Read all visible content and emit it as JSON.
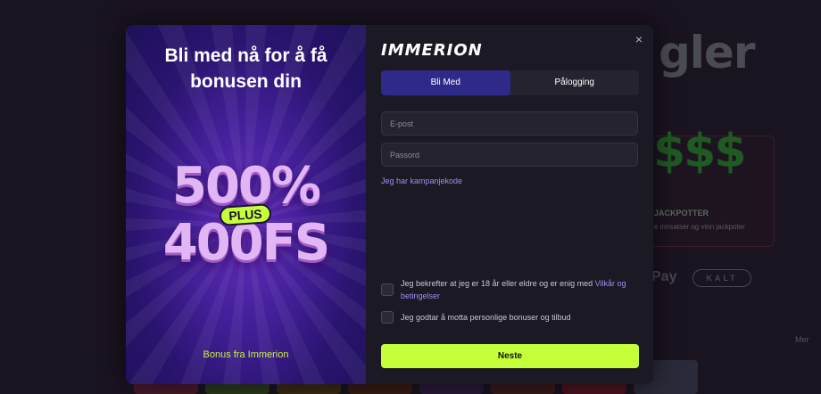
{
  "background": {
    "title_fragment": "gler",
    "jackpot_symbol": "$$$",
    "jackpot_title": "JACKPOTTER",
    "jackpot_sub": "e innsatser og vinn jackpoter",
    "pay_text": "Pay",
    "klarna_text": "KALT",
    "more_label": "Mer"
  },
  "promo": {
    "title": "Bli med nå for å få bonusen din",
    "big_top": "500%",
    "plus": "PLUS",
    "big_bottom": "400FS",
    "caption": "Bonus fra Immerion"
  },
  "form": {
    "logo": "IMMERION",
    "close_icon": "×",
    "tabs": [
      {
        "label": "Bli Med",
        "active": true
      },
      {
        "label": "Pålogging",
        "active": false
      }
    ],
    "email_placeholder": "E-post",
    "password_placeholder": "Passord",
    "campaign_link": "Jeg har kampanjekode",
    "consent_text": "Jeg bekrefter at jeg er 18 år eller eldre og er enig med",
    "consent_link": "Vilkår og betingelser",
    "bonus_text": "Jeg godtar å motta personlige bonuser og tilbud",
    "submit_label": "Neste"
  },
  "colors": {
    "accent_green": "#c5ff3a",
    "tab_active": "#2e2a8a",
    "link_purple": "#a58cf0"
  }
}
